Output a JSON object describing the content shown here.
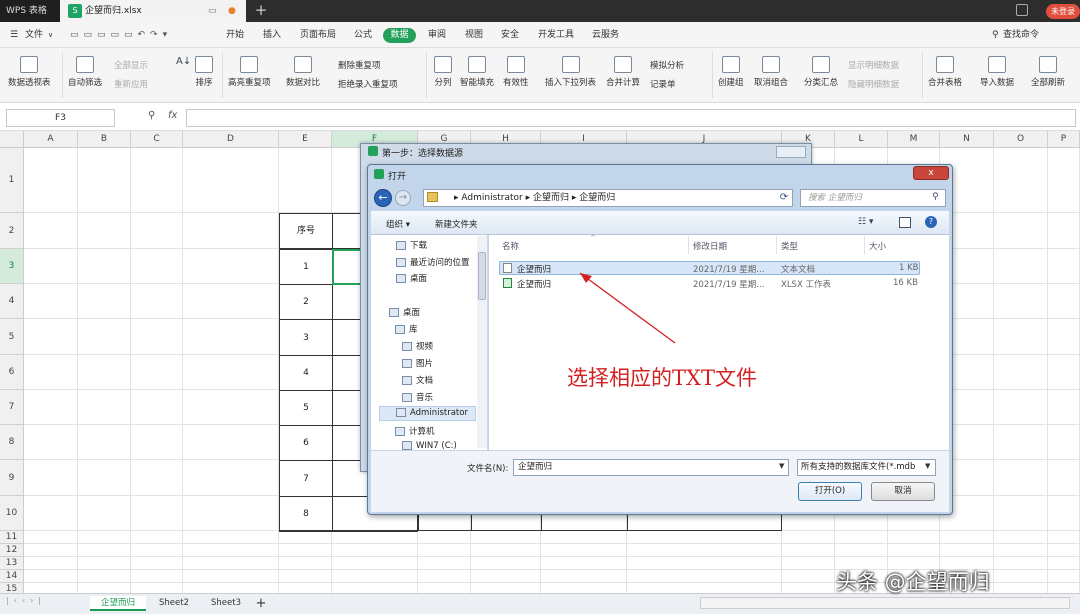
{
  "titlebar": {
    "app": "WPS 表格",
    "file": "企望而归.xlsx",
    "new_tab": "+",
    "login": "未登录"
  },
  "menu": {
    "file": "文件",
    "tabs": [
      "开始",
      "插入",
      "页面布局",
      "公式",
      "数据",
      "审阅",
      "视图",
      "安全",
      "开发工具",
      "云服务"
    ],
    "active_tab": "数据",
    "search": "查找命令"
  },
  "ribbon": {
    "pivot": "数据透视表",
    "autofilter": "自动筛选",
    "show_all": "全部显示",
    "reapply": "重新应用",
    "sort": "排序",
    "highlight_dup": "高亮重复项",
    "compare": "数据对比",
    "remove_dup": "删除重复项",
    "reject_dup": "拒绝录入重复项",
    "split": "分列",
    "smart_fill": "智能填充",
    "validity": "有效性",
    "dropdown": "插入下拉列表",
    "merge_calc": "合并计算",
    "simulate": "模拟分析",
    "record": "记录单",
    "group": "创建组",
    "ungroup": "取消组合",
    "subtotal": "分类汇总",
    "show_detail": "显示明细数据",
    "hide_detail": "隐藏明细数据",
    "merge_table": "合并表格",
    "import": "导入数据",
    "refresh_all": "全部刷新"
  },
  "formula_bar": {
    "name_box": "F3",
    "fx": "fx",
    "value": ""
  },
  "grid": {
    "columns": [
      "A",
      "B",
      "C",
      "D",
      "E",
      "F",
      "G",
      "H",
      "I",
      "J",
      "K",
      "L",
      "M",
      "N",
      "O",
      "P"
    ],
    "rows": [
      "1",
      "2",
      "3",
      "4",
      "5",
      "6",
      "7",
      "8",
      "9",
      "10",
      "11",
      "12",
      "13",
      "14",
      "15"
    ],
    "table_header": "序号",
    "table_numbers": [
      "1",
      "2",
      "3",
      "4",
      "5",
      "6",
      "7",
      "8"
    ]
  },
  "sheets": {
    "tabs": [
      "企望而归",
      "Sheet2",
      "Sheet3"
    ],
    "add": "+"
  },
  "dialog_select_source": {
    "title": "第一步：选择数据源"
  },
  "dialog_open": {
    "title": "打开",
    "close": "x",
    "breadcrumb": [
      "Administrator",
      "企望而归",
      "企望而归"
    ],
    "search_placeholder": "搜索 企望而归",
    "organize": "组织 ▾",
    "new_folder": "新建文件夹",
    "nav_items": [
      "下载",
      "最近访问的位置",
      "桌面",
      "桌面",
      "库",
      "视频",
      "图片",
      "文档",
      "音乐",
      "Administrator",
      "计算机",
      "WIN7 (C:)"
    ],
    "columns": [
      "名称",
      "修改日期",
      "类型",
      "大小"
    ],
    "files": [
      {
        "name": "企望而归",
        "date": "2021/7/19 星期...",
        "type": "文本文档",
        "size": "1 KB",
        "icon": "txt-file-icon"
      },
      {
        "name": "企望而归",
        "date": "2021/7/19 星期...",
        "type": "XLSX 工作表",
        "size": "16 KB",
        "icon": "xlsx-file-icon"
      }
    ],
    "filename_label": "文件名(N):",
    "filename_value": "企望而归",
    "filetype": "所有支持的数据库文件(*.mdb",
    "open": "打开(O)",
    "cancel": "取消"
  },
  "annotation": "选择相应的TXT文件",
  "watermark": "头条 @企望而归",
  "colors": {
    "accent_green": "#23a05a",
    "annotation_red": "#d42020",
    "selection_blue": "#d6e6f8"
  }
}
